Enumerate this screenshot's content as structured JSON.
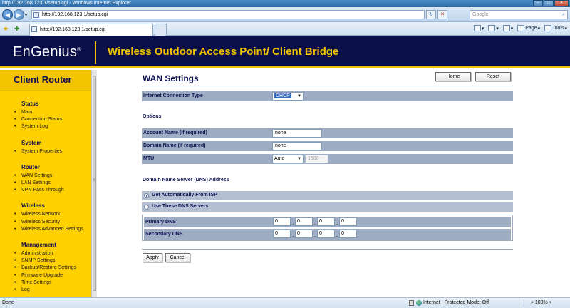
{
  "browser": {
    "window_title": "http://192.168.123.1/setup.cgi - Windows Internet Explorer",
    "address": "http://192.168.123.1/setup.cgi",
    "search_placeholder": "Google",
    "tab_title": "http://192.168.123.1/setup.cgi",
    "command_bar": {
      "page": "Page",
      "tools": "Tools"
    },
    "status": {
      "left": "Done",
      "zone": "Internet | Protected Mode: Off",
      "zoom": "100%"
    }
  },
  "banner": {
    "logo": "EnGenius",
    "title": "Wireless Outdoor Access Point/ Client Bridge"
  },
  "sidebar": {
    "title": "Client Router",
    "groups": [
      {
        "heading": "Status",
        "items": [
          "Main",
          "Connection Status",
          "System Log"
        ]
      },
      {
        "heading": "System",
        "items": [
          "System Properties"
        ]
      },
      {
        "heading": "Router",
        "items": [
          "WAN Settings",
          "LAN Settings",
          "VPN Pass Through"
        ]
      },
      {
        "heading": "Wireless",
        "items": [
          "Wireless Network",
          "Wireless Security",
          "Wireless Advanced Settings"
        ]
      },
      {
        "heading": "Management",
        "items": [
          "Administration",
          "SNMP Settings",
          "Backup/Restore Settings",
          "Firmware Upgrade",
          "Time Settings",
          "Log"
        ]
      }
    ]
  },
  "main": {
    "title": "WAN Settings",
    "home_button": "Home",
    "reset_button": "Reset",
    "connection_type": {
      "label": "Internet Connection Type",
      "value": "DHCP"
    },
    "options_heading": "Options",
    "account_name": {
      "label": "Account Name (if required)",
      "value": "none"
    },
    "domain_name": {
      "label": "Domain Name (if required)",
      "value": "none"
    },
    "mtu": {
      "label": "MTU",
      "mode": "Auto",
      "value": "1500"
    },
    "dns_heading": "Domain Name Server (DNS) Address",
    "dns_auto": "Get Automatically From ISP",
    "dns_manual": "Use These DNS Servers",
    "primary_dns": {
      "label": "Primary DNS",
      "octets": [
        "0",
        "0",
        "0",
        "0"
      ]
    },
    "secondary_dns": {
      "label": "Secondary DNS",
      "octets": [
        "0",
        "0",
        "0",
        "0"
      ]
    },
    "apply_button": "Apply",
    "cancel_button": "Cancel"
  }
}
